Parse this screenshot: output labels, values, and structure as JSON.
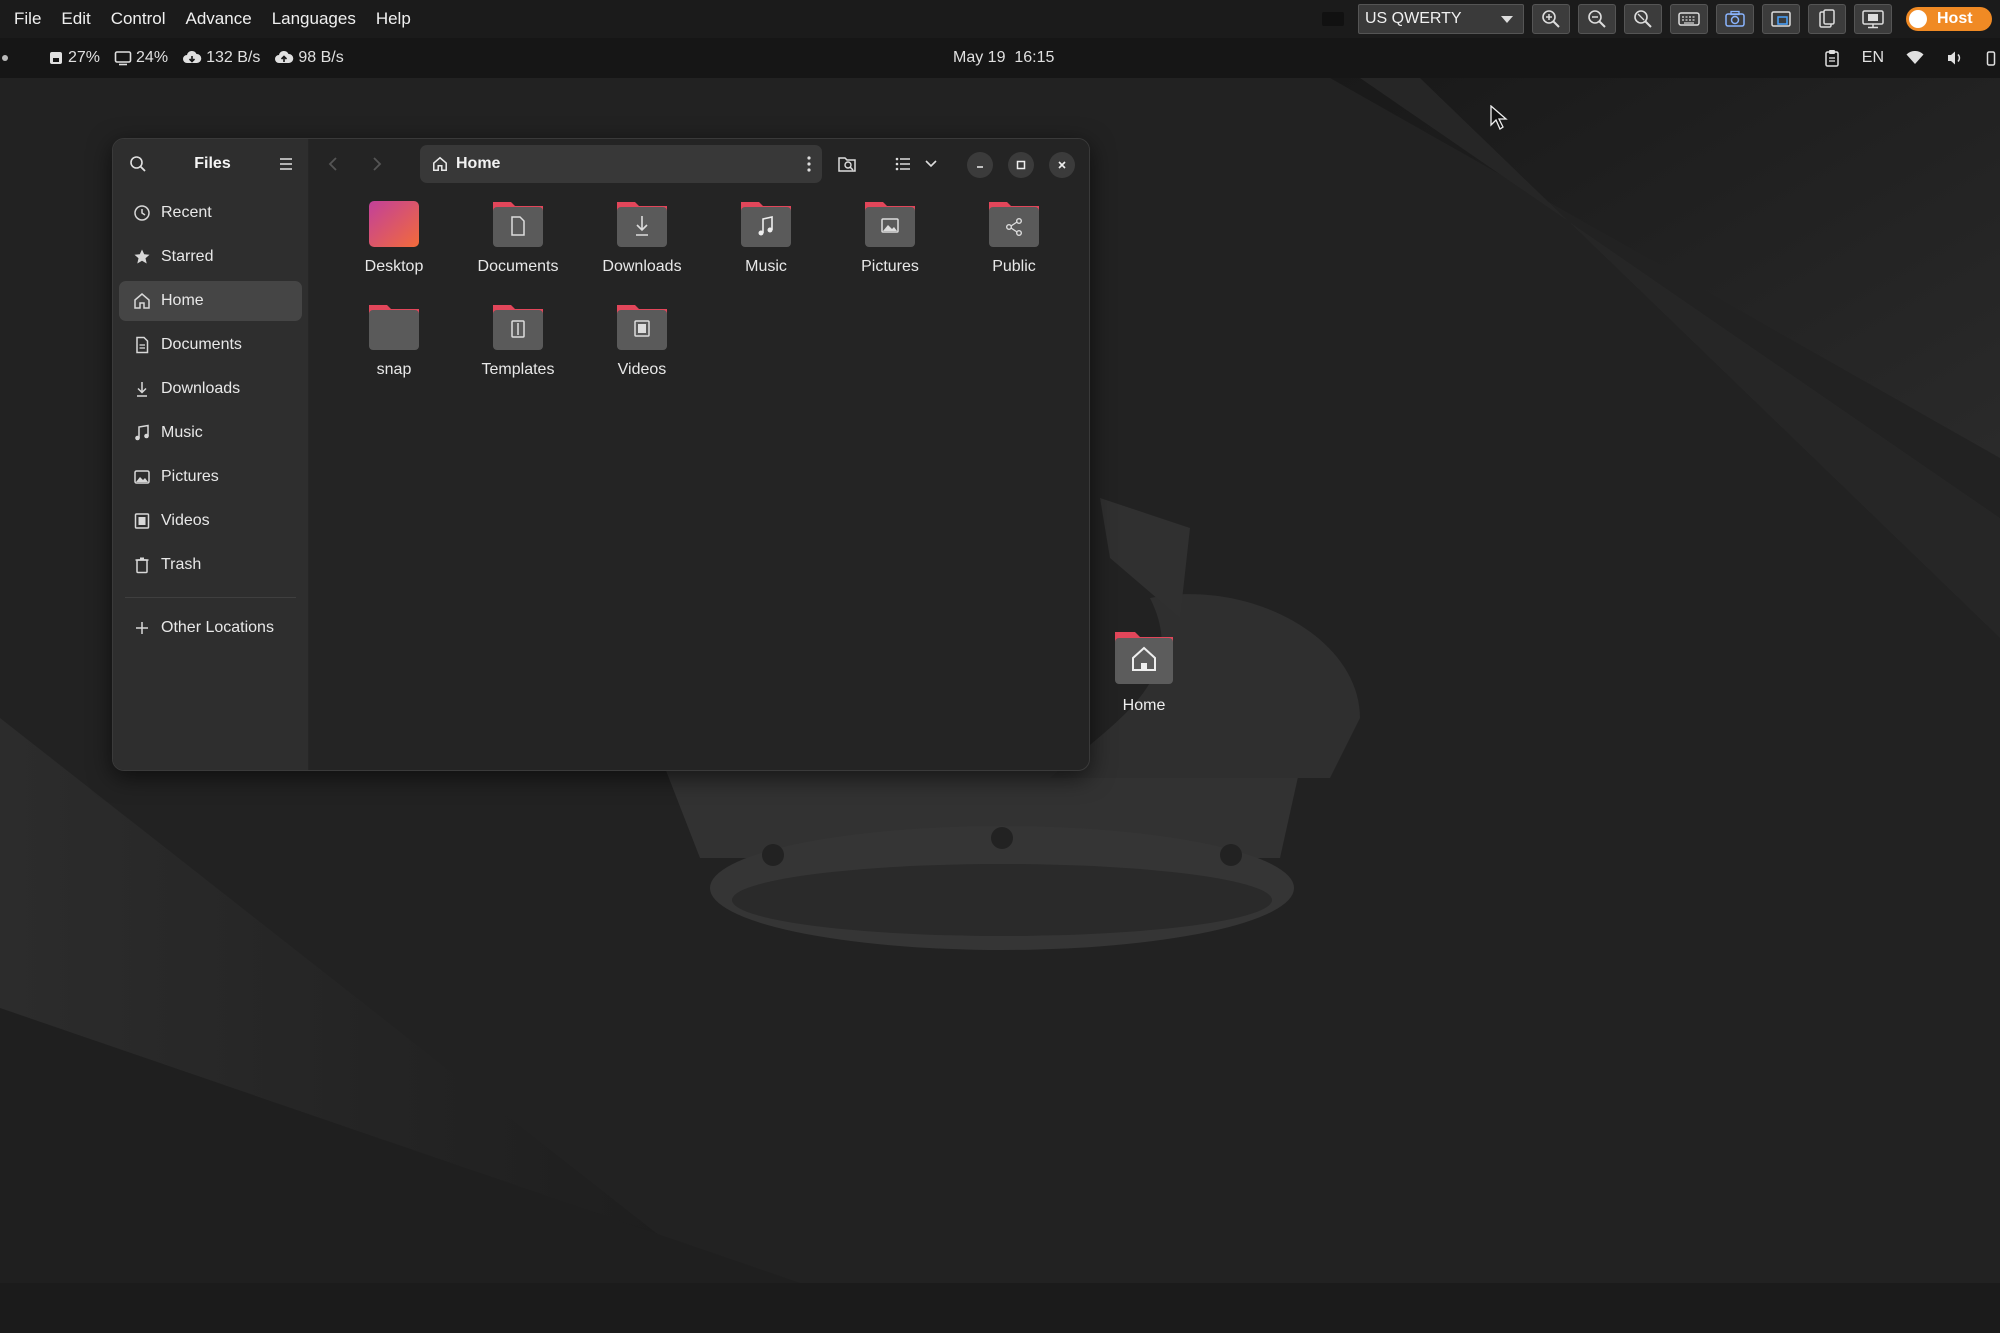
{
  "viewer_menu": [
    "File",
    "Edit",
    "Control",
    "Advance",
    "Languages",
    "Help"
  ],
  "keyboard_layout": "US QWERTY",
  "host_toggle_label": "Host",
  "panel": {
    "disk": "27%",
    "cpu": "24%",
    "down": "132 B/s",
    "up": "98 B/s",
    "date": "May 19",
    "time": "16:15",
    "lang": "EN"
  },
  "files": {
    "app_title": "Files",
    "path": "Home",
    "sidebar": [
      {
        "label": "Recent",
        "icon": "clock-icon"
      },
      {
        "label": "Starred",
        "icon": "star-icon"
      },
      {
        "label": "Home",
        "icon": "home-icon",
        "active": true
      },
      {
        "label": "Documents",
        "icon": "document-icon"
      },
      {
        "label": "Downloads",
        "icon": "download-icon"
      },
      {
        "label": "Music",
        "icon": "music-icon"
      },
      {
        "label": "Pictures",
        "icon": "picture-icon"
      },
      {
        "label": "Videos",
        "icon": "video-icon"
      },
      {
        "label": "Trash",
        "icon": "trash-icon"
      }
    ],
    "other_locations": "Other Locations",
    "items": [
      {
        "label": "Desktop",
        "icon": "desktop-folder-icon"
      },
      {
        "label": "Documents",
        "icon": "documents-folder-icon"
      },
      {
        "label": "Downloads",
        "icon": "downloads-folder-icon"
      },
      {
        "label": "Music",
        "icon": "music-folder-icon"
      },
      {
        "label": "Pictures",
        "icon": "pictures-folder-icon"
      },
      {
        "label": "Public",
        "icon": "public-folder-icon"
      },
      {
        "label": "snap",
        "icon": "folder-icon"
      },
      {
        "label": "Templates",
        "icon": "templates-folder-icon"
      },
      {
        "label": "Videos",
        "icon": "videos-folder-icon"
      }
    ]
  },
  "desktop": {
    "home_label": "Home"
  },
  "colors": {
    "accent_orange": "#f08a24",
    "folder_tab": "#e2465a",
    "folder_body": "#5a5a5a"
  }
}
